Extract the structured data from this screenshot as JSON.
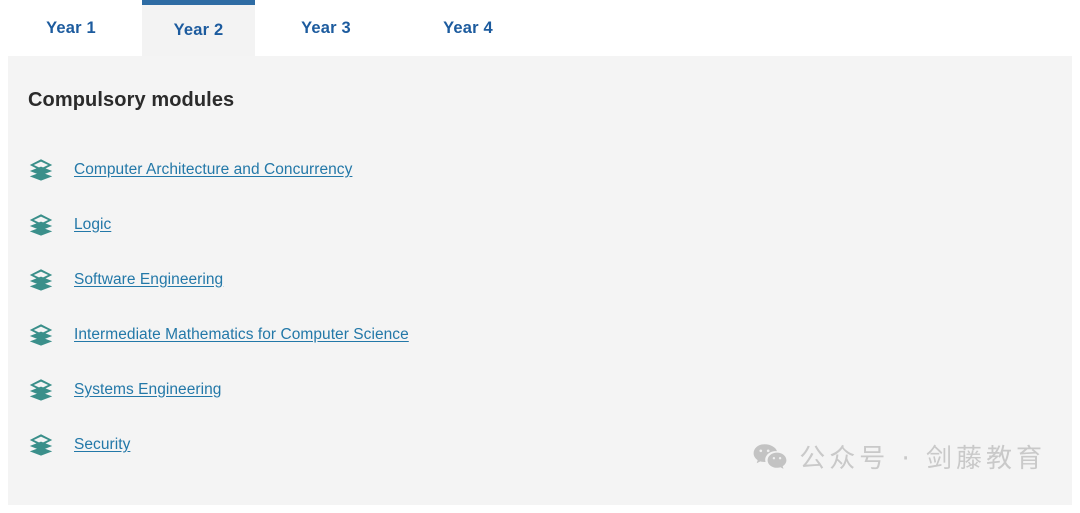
{
  "tabs": {
    "items": [
      {
        "label": "Year 1",
        "active": false
      },
      {
        "label": "Year 2",
        "active": true
      },
      {
        "label": "Year 3",
        "active": false
      },
      {
        "label": "Year 4",
        "active": false
      }
    ]
  },
  "panel": {
    "heading": "Compulsory modules",
    "modules": [
      {
        "label": "Computer Architecture and Concurrency",
        "icon": "layers-icon"
      },
      {
        "label": "Logic",
        "icon": "layers-icon"
      },
      {
        "label": "Software Engineering",
        "icon": "layers-icon"
      },
      {
        "label": "Intermediate Mathematics for Computer Science",
        "icon": "layers-icon"
      },
      {
        "label": "Systems Engineering",
        "icon": "layers-icon"
      },
      {
        "label": "Security",
        "icon": "layers-icon"
      }
    ]
  },
  "watermark": {
    "icon": "wechat-icon",
    "text": "公众号 · 剑藤教育"
  },
  "colors": {
    "tab_text": "#1c5b9e",
    "active_tab_border": "#2e6ca4",
    "active_tab_background": "#f3f3f3",
    "panel_background": "#f4f4f4",
    "heading_text": "#2b2b2b",
    "link_text": "#2378a8",
    "module_icon": "#3a8f8a",
    "watermark_text": "#c9c9c9",
    "page_background": "#ffffff"
  }
}
